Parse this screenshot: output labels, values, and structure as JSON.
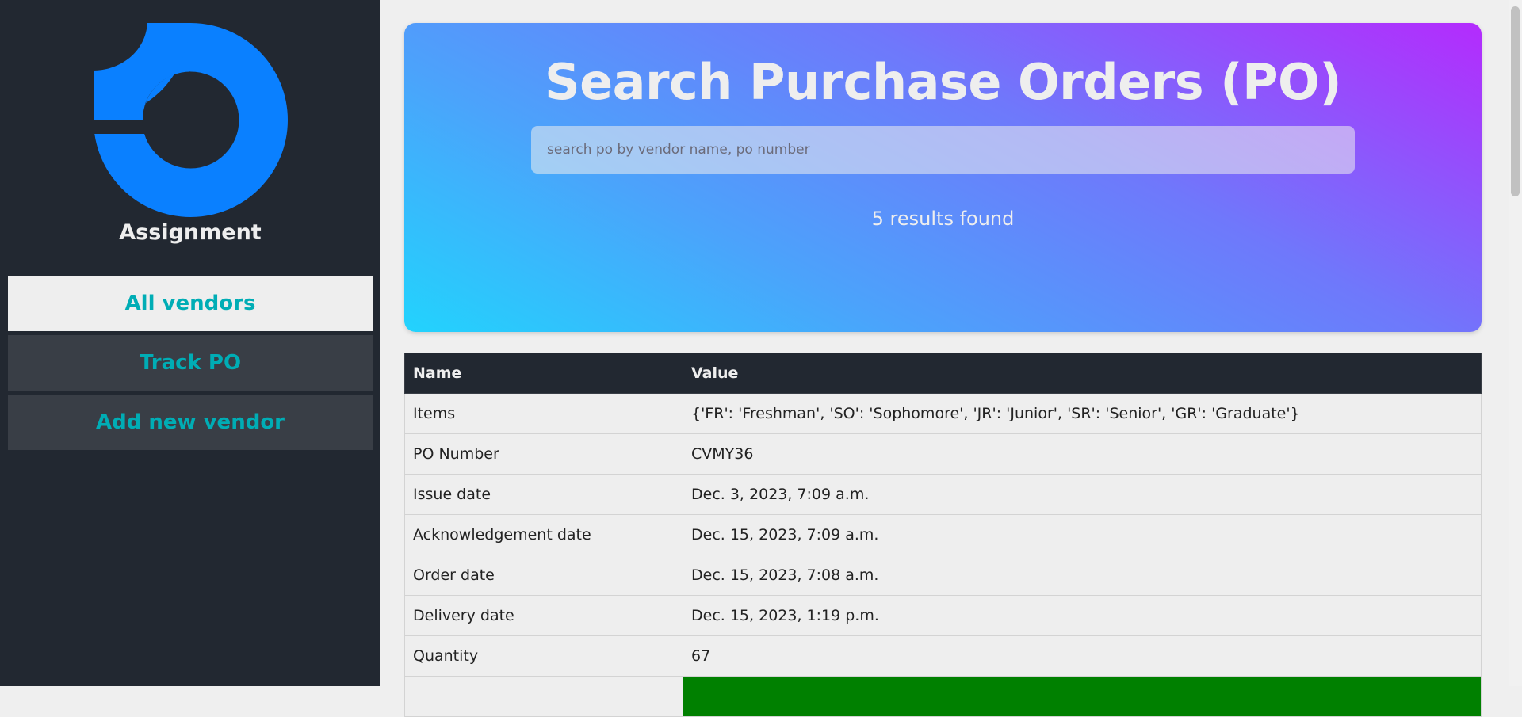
{
  "sidebar": {
    "brand": "Assignment",
    "logo_color": "#0a80ff",
    "nav": [
      {
        "label": "All vendors",
        "active": true
      },
      {
        "label": "Track PO",
        "active": false
      },
      {
        "label": "Add new vendor",
        "active": false
      }
    ]
  },
  "hero": {
    "title": "Search Purchase Orders (PO)",
    "search_placeholder": "search po by vendor name, po number",
    "search_value": "",
    "results_text": "5 results found"
  },
  "table": {
    "headers": [
      "Name",
      "Value"
    ],
    "rows": [
      {
        "name": "Items",
        "value": "{'FR': 'Freshman', 'SO': 'Sophomore', 'JR': 'Junior', 'SR': 'Senior', 'GR': 'Graduate'}"
      },
      {
        "name": "PO Number",
        "value": "CVMY36"
      },
      {
        "name": "Issue date",
        "value": "Dec. 3, 2023, 7:09 a.m."
      },
      {
        "name": "Acknowledgement date",
        "value": "Dec. 15, 2023, 7:09 a.m."
      },
      {
        "name": "Order date",
        "value": "Dec. 15, 2023, 7:08 a.m."
      },
      {
        "name": "Delivery date",
        "value": "Dec. 15, 2023, 1:19 p.m."
      },
      {
        "name": "Quantity",
        "value": "67"
      }
    ],
    "status_color": "#008000"
  },
  "colors": {
    "sidebar_bg": "#222831",
    "accent": "#00adb5",
    "header_bg": "#222831"
  }
}
